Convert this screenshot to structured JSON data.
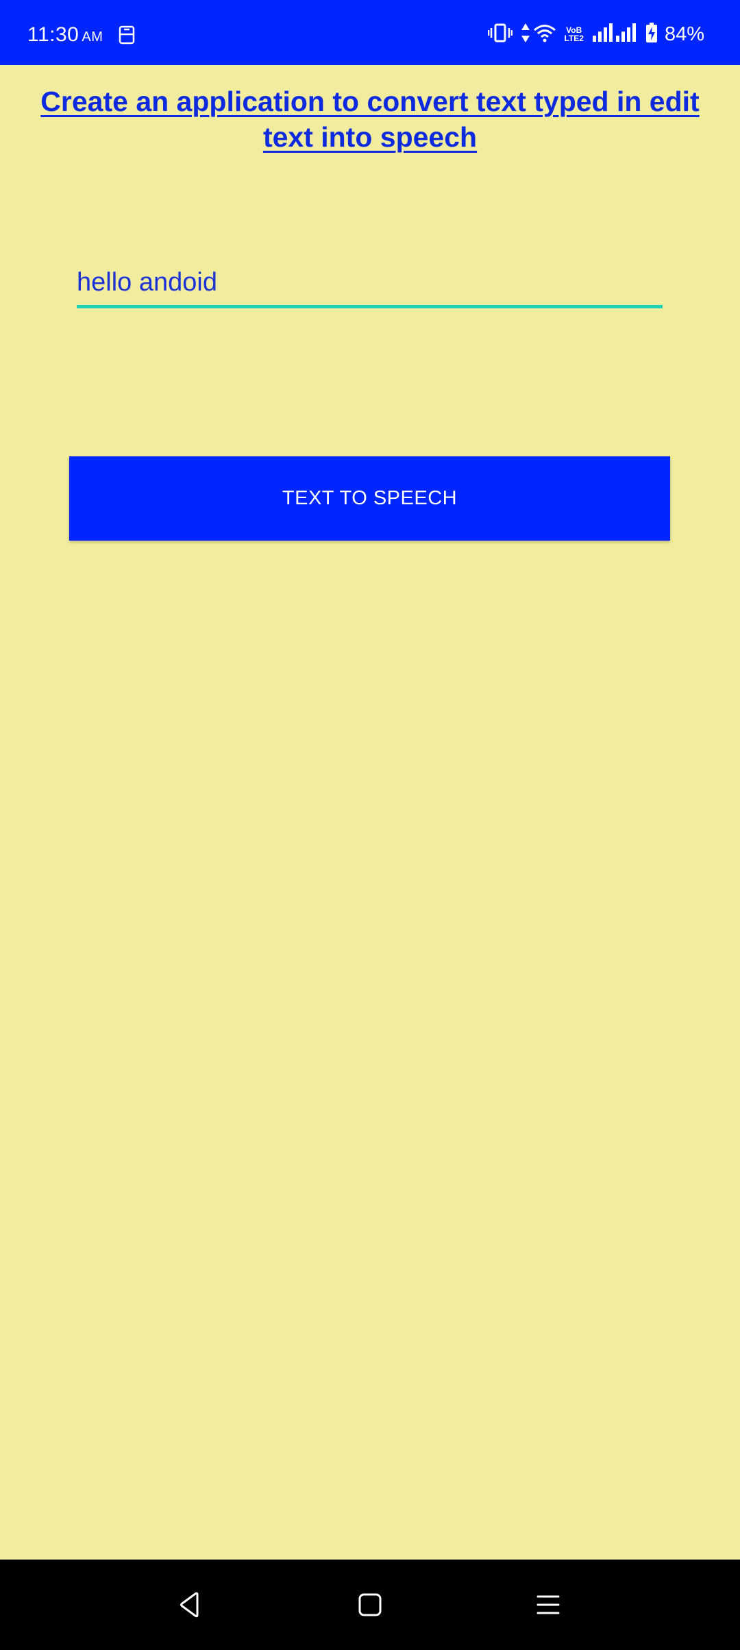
{
  "status_bar": {
    "time": "11:30",
    "ampm": "AM",
    "battery_percent": "84%",
    "colors": {
      "background": "#0026ff",
      "foreground": "#ffffff"
    },
    "icons": [
      "sim-notification-icon",
      "vibrate-icon",
      "data-arrows-icon",
      "wifi-icon",
      "volte-icon",
      "signal-icon",
      "signal-icon",
      "battery-charging-icon"
    ],
    "vo_label": "VoB",
    "lte_label": "LTE2"
  },
  "main": {
    "title": "Create an application to convert text typed in edit text into speech",
    "input": {
      "value": "hello andoid",
      "placeholder": ""
    },
    "button": {
      "label": "TEXT TO SPEECH"
    },
    "colors": {
      "background": "#f2ed9e",
      "title": "#0d2adf",
      "input_text": "#1a32d6",
      "input_underline": "#1ed2b4",
      "button": "#0026ff"
    }
  },
  "nav_bar": {
    "icons": [
      "back-icon",
      "home-icon",
      "recents-menu-icon"
    ]
  }
}
